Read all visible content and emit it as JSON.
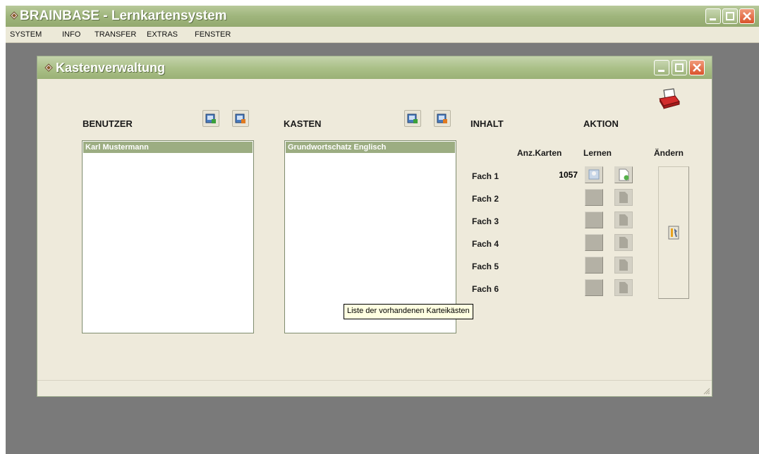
{
  "app": {
    "title": "BRAINBASE - Lernkartensystem",
    "menu": [
      "SYSTEM",
      "INFO",
      "TRANSFER",
      "EXTRAS",
      "FENSTER"
    ]
  },
  "window": {
    "title": "Kastenverwaltung"
  },
  "benutzer": {
    "heading": "BENUTZER",
    "items": [
      "Karl Mustermann"
    ]
  },
  "kasten": {
    "heading": "KASTEN",
    "items": [
      "Grundwortschatz Englisch"
    ]
  },
  "inhalt": {
    "heading": "INHALT",
    "count_header": "Anz.Karten",
    "faecher": [
      {
        "label": "Fach 1",
        "count": "1057"
      },
      {
        "label": "Fach 2",
        "count": ""
      },
      {
        "label": "Fach 3",
        "count": ""
      },
      {
        "label": "Fach 4",
        "count": ""
      },
      {
        "label": "Fach 5",
        "count": ""
      },
      {
        "label": "Fach 6",
        "count": ""
      }
    ]
  },
  "aktion": {
    "heading": "AKTION",
    "lernen": "Lernen",
    "aendern": "Ändern"
  },
  "tooltip": "Liste der vorhandenen Karteikästen",
  "icons": {
    "add_user": "add-icon",
    "edit_user": "edit-icon",
    "add_box": "add-icon",
    "edit_box": "edit-icon",
    "print": "printer-icon",
    "aendern": "tools-icon"
  },
  "colors": {
    "title_bar": "#9fb57c",
    "selection": "#9cad82",
    "close_button": "#d9532b"
  }
}
